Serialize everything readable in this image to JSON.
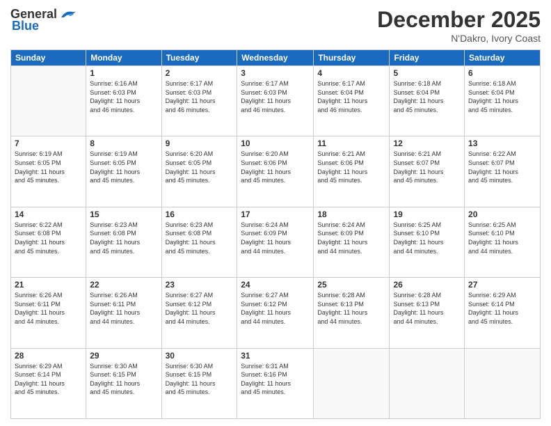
{
  "header": {
    "logo_general": "General",
    "logo_blue": "Blue",
    "month_title": "December 2025",
    "subtitle": "N'Dakro, Ivory Coast"
  },
  "days_of_week": [
    "Sunday",
    "Monday",
    "Tuesday",
    "Wednesday",
    "Thursday",
    "Friday",
    "Saturday"
  ],
  "weeks": [
    [
      {
        "day": "",
        "info": ""
      },
      {
        "day": "1",
        "info": "Sunrise: 6:16 AM\nSunset: 6:03 PM\nDaylight: 11 hours\nand 46 minutes."
      },
      {
        "day": "2",
        "info": "Sunrise: 6:17 AM\nSunset: 6:03 PM\nDaylight: 11 hours\nand 46 minutes."
      },
      {
        "day": "3",
        "info": "Sunrise: 6:17 AM\nSunset: 6:03 PM\nDaylight: 11 hours\nand 46 minutes."
      },
      {
        "day": "4",
        "info": "Sunrise: 6:17 AM\nSunset: 6:04 PM\nDaylight: 11 hours\nand 46 minutes."
      },
      {
        "day": "5",
        "info": "Sunrise: 6:18 AM\nSunset: 6:04 PM\nDaylight: 11 hours\nand 45 minutes."
      },
      {
        "day": "6",
        "info": "Sunrise: 6:18 AM\nSunset: 6:04 PM\nDaylight: 11 hours\nand 45 minutes."
      }
    ],
    [
      {
        "day": "7",
        "info": "Sunrise: 6:19 AM\nSunset: 6:05 PM\nDaylight: 11 hours\nand 45 minutes."
      },
      {
        "day": "8",
        "info": "Sunrise: 6:19 AM\nSunset: 6:05 PM\nDaylight: 11 hours\nand 45 minutes."
      },
      {
        "day": "9",
        "info": "Sunrise: 6:20 AM\nSunset: 6:05 PM\nDaylight: 11 hours\nand 45 minutes."
      },
      {
        "day": "10",
        "info": "Sunrise: 6:20 AM\nSunset: 6:06 PM\nDaylight: 11 hours\nand 45 minutes."
      },
      {
        "day": "11",
        "info": "Sunrise: 6:21 AM\nSunset: 6:06 PM\nDaylight: 11 hours\nand 45 minutes."
      },
      {
        "day": "12",
        "info": "Sunrise: 6:21 AM\nSunset: 6:07 PM\nDaylight: 11 hours\nand 45 minutes."
      },
      {
        "day": "13",
        "info": "Sunrise: 6:22 AM\nSunset: 6:07 PM\nDaylight: 11 hours\nand 45 minutes."
      }
    ],
    [
      {
        "day": "14",
        "info": "Sunrise: 6:22 AM\nSunset: 6:08 PM\nDaylight: 11 hours\nand 45 minutes."
      },
      {
        "day": "15",
        "info": "Sunrise: 6:23 AM\nSunset: 6:08 PM\nDaylight: 11 hours\nand 45 minutes."
      },
      {
        "day": "16",
        "info": "Sunrise: 6:23 AM\nSunset: 6:08 PM\nDaylight: 11 hours\nand 45 minutes."
      },
      {
        "day": "17",
        "info": "Sunrise: 6:24 AM\nSunset: 6:09 PM\nDaylight: 11 hours\nand 44 minutes."
      },
      {
        "day": "18",
        "info": "Sunrise: 6:24 AM\nSunset: 6:09 PM\nDaylight: 11 hours\nand 44 minutes."
      },
      {
        "day": "19",
        "info": "Sunrise: 6:25 AM\nSunset: 6:10 PM\nDaylight: 11 hours\nand 44 minutes."
      },
      {
        "day": "20",
        "info": "Sunrise: 6:25 AM\nSunset: 6:10 PM\nDaylight: 11 hours\nand 44 minutes."
      }
    ],
    [
      {
        "day": "21",
        "info": "Sunrise: 6:26 AM\nSunset: 6:11 PM\nDaylight: 11 hours\nand 44 minutes."
      },
      {
        "day": "22",
        "info": "Sunrise: 6:26 AM\nSunset: 6:11 PM\nDaylight: 11 hours\nand 44 minutes."
      },
      {
        "day": "23",
        "info": "Sunrise: 6:27 AM\nSunset: 6:12 PM\nDaylight: 11 hours\nand 44 minutes."
      },
      {
        "day": "24",
        "info": "Sunrise: 6:27 AM\nSunset: 6:12 PM\nDaylight: 11 hours\nand 44 minutes."
      },
      {
        "day": "25",
        "info": "Sunrise: 6:28 AM\nSunset: 6:13 PM\nDaylight: 11 hours\nand 44 minutes."
      },
      {
        "day": "26",
        "info": "Sunrise: 6:28 AM\nSunset: 6:13 PM\nDaylight: 11 hours\nand 44 minutes."
      },
      {
        "day": "27",
        "info": "Sunrise: 6:29 AM\nSunset: 6:14 PM\nDaylight: 11 hours\nand 45 minutes."
      }
    ],
    [
      {
        "day": "28",
        "info": "Sunrise: 6:29 AM\nSunset: 6:14 PM\nDaylight: 11 hours\nand 45 minutes."
      },
      {
        "day": "29",
        "info": "Sunrise: 6:30 AM\nSunset: 6:15 PM\nDaylight: 11 hours\nand 45 minutes."
      },
      {
        "day": "30",
        "info": "Sunrise: 6:30 AM\nSunset: 6:15 PM\nDaylight: 11 hours\nand 45 minutes."
      },
      {
        "day": "31",
        "info": "Sunrise: 6:31 AM\nSunset: 6:16 PM\nDaylight: 11 hours\nand 45 minutes."
      },
      {
        "day": "",
        "info": ""
      },
      {
        "day": "",
        "info": ""
      },
      {
        "day": "",
        "info": ""
      }
    ]
  ]
}
